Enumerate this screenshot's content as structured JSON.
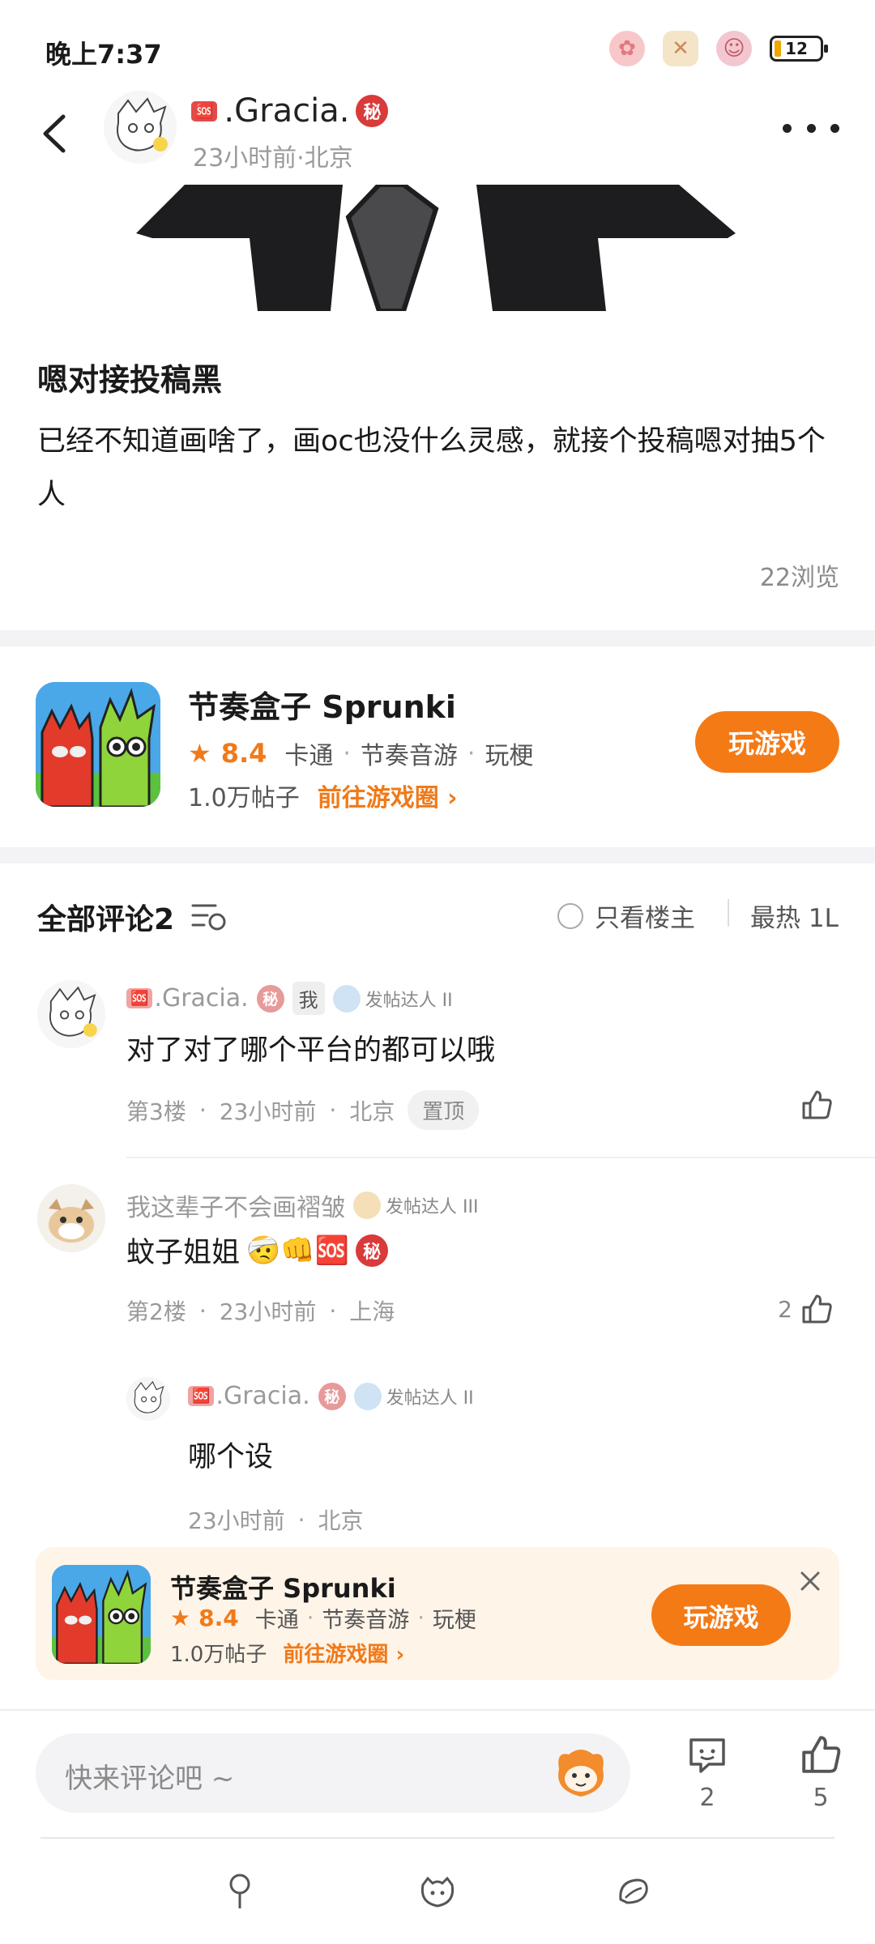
{
  "status": {
    "time": "晚上7:37",
    "battery": "12",
    "icons": [
      "flower-icon",
      "bandage-icon",
      "bunny-icon"
    ]
  },
  "header": {
    "user_prefix": "🆘",
    "user_name": ".Gracia.",
    "secret_badge": "秘",
    "meta": "23小时前·北京"
  },
  "post": {
    "title": "嗯对接投稿黑",
    "body": "已经不知道画啥了，画oc也没什么灵感，就接个投稿嗯对抽5个人",
    "views": "22浏览"
  },
  "game_card": {
    "name": "节奏盒子 Sprunki",
    "rating": "8.4",
    "tags": [
      "卡通",
      "节奏音游",
      "玩梗"
    ],
    "posts": "1.0万帖子",
    "link": "前往游戏圈",
    "play_label": "玩游戏"
  },
  "comments_section": {
    "title": "全部评论2",
    "only_op_label": "只看楼主",
    "sort_label": "最热 1L"
  },
  "comments": [
    {
      "author": ".Gracia.",
      "author_prefix": "🆘",
      "secret_badge": "秘",
      "me_tag": "我",
      "level": "发帖达人 II",
      "text": "对了对了哪个平台的都可以哦",
      "floor": "第3楼",
      "time": "23小时前",
      "location": "北京",
      "pin": "置顶",
      "likes": ""
    },
    {
      "author": "我这辈子不会画褶皱",
      "level": "发帖达人 III",
      "text": "蚊子姐姐",
      "text_emojis": "🤕👊🆘",
      "secret_badge": "秘",
      "floor": "第2楼",
      "time": "23小时前",
      "location": "上海",
      "likes": "2"
    }
  ],
  "reply": {
    "author_prefix": "🆘",
    "author": ".Gracia.",
    "secret_badge": "秘",
    "level": "发帖达人 II",
    "text": "哪个设",
    "time": "23小时前",
    "location": "北京"
  },
  "floating_banner": {
    "name": "节奏盒子 Sprunki",
    "rating": "8.4",
    "tags": [
      "卡通",
      "节奏音游",
      "玩梗"
    ],
    "posts": "1.0万帖子",
    "link": "前往游戏圈",
    "play_label": "玩游戏"
  },
  "bottom_bar": {
    "placeholder": "快来评论吧 ~",
    "comment_count": "2",
    "like_count": "5"
  },
  "colors": {
    "accent": "#f47a16",
    "rating": "#f07a1a",
    "muted": "#9a9a9a",
    "divider": "#f3f3f5"
  }
}
